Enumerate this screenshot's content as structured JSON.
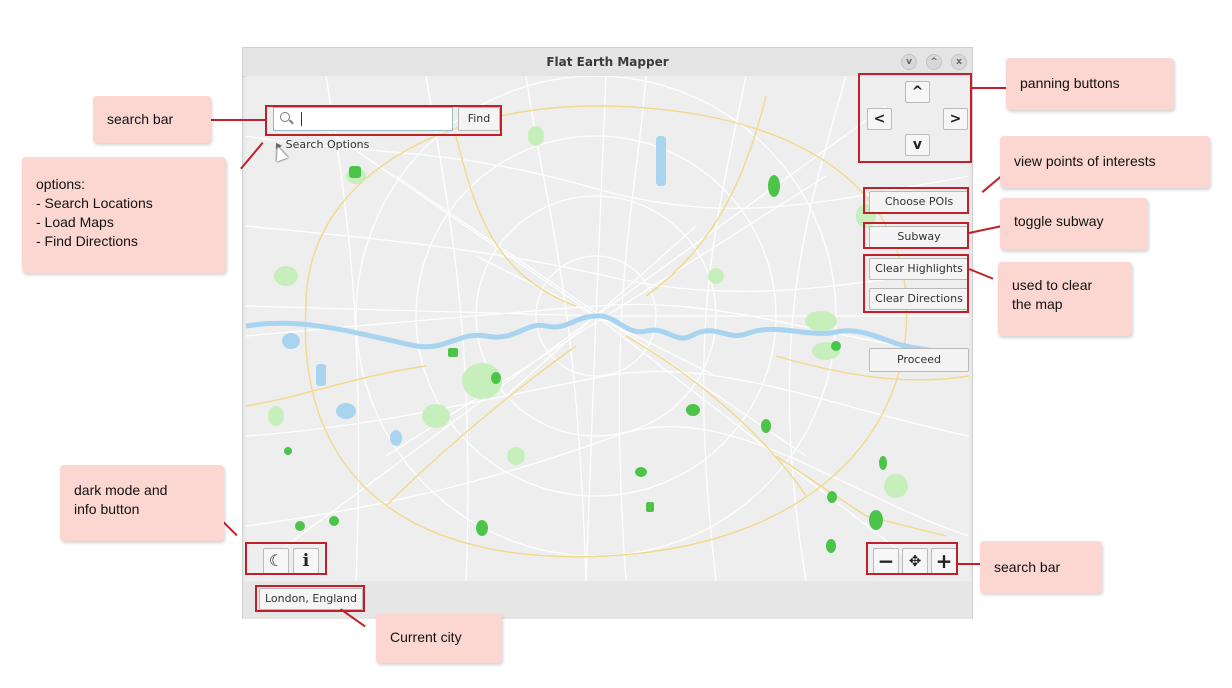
{
  "window": {
    "title": "Flat Earth Mapper",
    "controls": [
      "minimize",
      "maximize",
      "close"
    ]
  },
  "search": {
    "value": "",
    "find_label": "Find",
    "options_label": "Search Options"
  },
  "panning": {
    "up": "^",
    "left": "<",
    "right": ">",
    "down": "v"
  },
  "side_buttons": {
    "choose_pois": "Choose POIs",
    "subway": "Subway",
    "clear_highlights": "Clear Highlights",
    "clear_directions": "Clear Directions",
    "proceed": "Proceed"
  },
  "bottom_left": {
    "dark_mode_icon": "moon-icon",
    "info_icon": "info-icon"
  },
  "zoom": {
    "zoom_out_icon": "minus-icon",
    "fit_icon": "expand-icon",
    "zoom_in_icon": "plus-icon"
  },
  "status": {
    "city": "London, England"
  },
  "annotations": {
    "search_bar": "search bar",
    "options_title": "options:",
    "options_items": [
      "- Search Locations",
      "- Load Maps",
      "- Find Directions"
    ],
    "panning": "panning buttons",
    "pois": "view points of interests",
    "subway": "toggle subway",
    "clear_line1": "used to clear",
    "clear_line2": "the map",
    "dark_line1": "dark mode and",
    "dark_line2": "info button",
    "zoom": "search bar",
    "city": "Current city"
  },
  "colors": {
    "annotation_box": "#fcd7d1",
    "annotation_line": "#c0202a",
    "river": "#a8d4f0",
    "park": "#9fe08c",
    "road_major": "#f3d98a"
  }
}
